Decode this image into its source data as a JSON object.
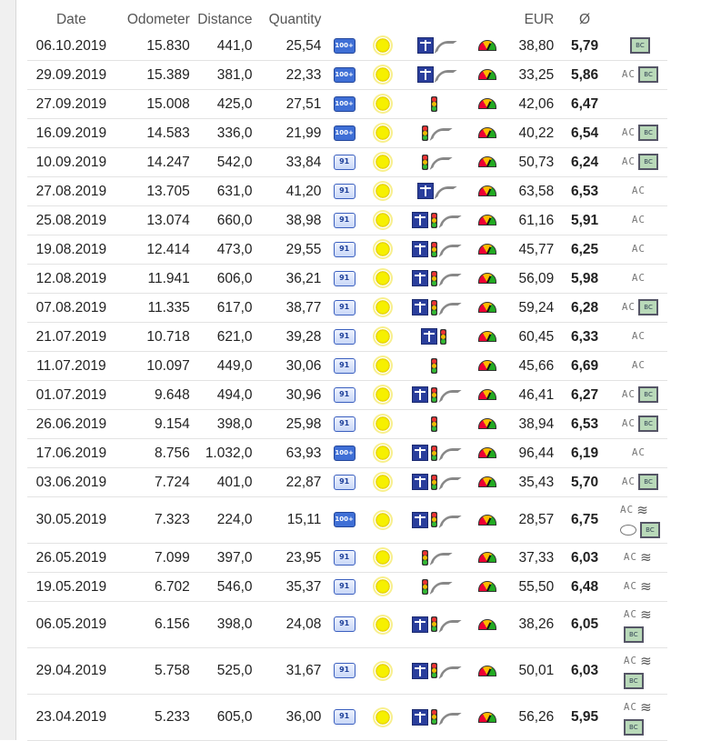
{
  "headers": {
    "date": "Date",
    "odometer": "Odometer",
    "distance": "Distance",
    "quantity": "Quantity",
    "eur": "EUR",
    "avg": "Ø"
  },
  "icons": {
    "fuel_100": "100+",
    "fuel_91": "91",
    "ac": "AC",
    "bc": "BC",
    "heat": "≋"
  },
  "rows": [
    {
      "date": "06.10.2019",
      "odometer": "15.830",
      "distance": "441,0",
      "quantity": "25,54",
      "fuel": "100+",
      "road": [
        "hw",
        "cv"
      ],
      "eur": "38,80",
      "avg": "5,79",
      "extras": [
        "bc"
      ]
    },
    {
      "date": "29.09.2019",
      "odometer": "15.389",
      "distance": "381,0",
      "quantity": "22,33",
      "fuel": "100+",
      "road": [
        "hw",
        "cv"
      ],
      "eur": "33,25",
      "avg": "5,86",
      "extras": [
        "ac",
        "bc"
      ]
    },
    {
      "date": "27.09.2019",
      "odometer": "15.008",
      "distance": "425,0",
      "quantity": "27,51",
      "fuel": "100+",
      "road": [
        "tl"
      ],
      "eur": "42,06",
      "avg": "6,47",
      "extras": []
    },
    {
      "date": "16.09.2019",
      "odometer": "14.583",
      "distance": "336,0",
      "quantity": "21,99",
      "fuel": "100+",
      "road": [
        "tl",
        "cv"
      ],
      "eur": "40,22",
      "avg": "6,54",
      "extras": [
        "ac",
        "bc"
      ]
    },
    {
      "date": "10.09.2019",
      "odometer": "14.247",
      "distance": "542,0",
      "quantity": "33,84",
      "fuel": "91",
      "road": [
        "tl",
        "cv"
      ],
      "eur": "50,73",
      "avg": "6,24",
      "extras": [
        "ac",
        "bc"
      ]
    },
    {
      "date": "27.08.2019",
      "odometer": "13.705",
      "distance": "631,0",
      "quantity": "41,20",
      "fuel": "91",
      "road": [
        "hw",
        "cv"
      ],
      "eur": "63,58",
      "avg": "6,53",
      "extras": [
        "ac"
      ]
    },
    {
      "date": "25.08.2019",
      "odometer": "13.074",
      "distance": "660,0",
      "quantity": "38,98",
      "fuel": "91",
      "road": [
        "hw",
        "tl",
        "cv"
      ],
      "eur": "61,16",
      "avg": "5,91",
      "extras": [
        "ac"
      ]
    },
    {
      "date": "19.08.2019",
      "odometer": "12.414",
      "distance": "473,0",
      "quantity": "29,55",
      "fuel": "91",
      "road": [
        "hw",
        "tl",
        "cv"
      ],
      "eur": "45,77",
      "avg": "6,25",
      "extras": [
        "ac"
      ]
    },
    {
      "date": "12.08.2019",
      "odometer": "11.941",
      "distance": "606,0",
      "quantity": "36,21",
      "fuel": "91",
      "road": [
        "hw",
        "tl",
        "cv"
      ],
      "eur": "56,09",
      "avg": "5,98",
      "extras": [
        "ac"
      ]
    },
    {
      "date": "07.08.2019",
      "odometer": "11.335",
      "distance": "617,0",
      "quantity": "38,77",
      "fuel": "91",
      "road": [
        "hw",
        "tl",
        "cv"
      ],
      "eur": "59,24",
      "avg": "6,28",
      "extras": [
        "ac",
        "bc"
      ]
    },
    {
      "date": "21.07.2019",
      "odometer": "10.718",
      "distance": "621,0",
      "quantity": "39,28",
      "fuel": "91",
      "road": [
        "hw",
        "tl"
      ],
      "eur": "60,45",
      "avg": "6,33",
      "extras": [
        "ac"
      ]
    },
    {
      "date": "11.07.2019",
      "odometer": "10.097",
      "distance": "449,0",
      "quantity": "30,06",
      "fuel": "91",
      "road": [
        "tl"
      ],
      "eur": "45,66",
      "avg": "6,69",
      "extras": [
        "ac"
      ]
    },
    {
      "date": "01.07.2019",
      "odometer": "9.648",
      "distance": "494,0",
      "quantity": "30,96",
      "fuel": "91",
      "road": [
        "hw",
        "tl",
        "cv"
      ],
      "eur": "46,41",
      "avg": "6,27",
      "extras": [
        "ac",
        "bc"
      ]
    },
    {
      "date": "26.06.2019",
      "odometer": "9.154",
      "distance": "398,0",
      "quantity": "25,98",
      "fuel": "91",
      "road": [
        "tl"
      ],
      "eur": "38,94",
      "avg": "6,53",
      "extras": [
        "ac",
        "bc"
      ]
    },
    {
      "date": "17.06.2019",
      "odometer": "8.756",
      "distance": "1.032,0",
      "quantity": "63,93",
      "fuel": "100+",
      "road": [
        "hw",
        "tl",
        "cv"
      ],
      "eur": "96,44",
      "avg": "6,19",
      "extras": [
        "ac"
      ]
    },
    {
      "date": "03.06.2019",
      "odometer": "7.724",
      "distance": "401,0",
      "quantity": "22,87",
      "fuel": "91",
      "road": [
        "hw",
        "tl",
        "cv"
      ],
      "eur": "35,43",
      "avg": "5,70",
      "extras": [
        "ac",
        "bc"
      ]
    },
    {
      "date": "30.05.2019",
      "odometer": "7.323",
      "distance": "224,0",
      "quantity": "15,11",
      "fuel": "100+",
      "road": [
        "hw",
        "tl",
        "cv"
      ],
      "eur": "28,57",
      "avg": "6,75",
      "extras": [
        "ac",
        "heat",
        "br",
        "bubble",
        "bc"
      ],
      "tall": true
    },
    {
      "date": "26.05.2019",
      "odometer": "7.099",
      "distance": "397,0",
      "quantity": "23,95",
      "fuel": "91",
      "road": [
        "tl",
        "cv"
      ],
      "eur": "37,33",
      "avg": "6,03",
      "extras": [
        "ac",
        "heat"
      ]
    },
    {
      "date": "19.05.2019",
      "odometer": "6.702",
      "distance": "546,0",
      "quantity": "35,37",
      "fuel": "91",
      "road": [
        "tl",
        "cv"
      ],
      "eur": "55,50",
      "avg": "6,48",
      "extras": [
        "ac",
        "heat"
      ]
    },
    {
      "date": "06.05.2019",
      "odometer": "6.156",
      "distance": "398,0",
      "quantity": "24,08",
      "fuel": "91",
      "road": [
        "hw",
        "tl",
        "cv"
      ],
      "eur": "38,26",
      "avg": "6,05",
      "extras": [
        "ac",
        "heat",
        "br",
        "bc"
      ],
      "tall": true
    },
    {
      "date": "29.04.2019",
      "odometer": "5.758",
      "distance": "525,0",
      "quantity": "31,67",
      "fuel": "91",
      "road": [
        "hw",
        "tl",
        "cv"
      ],
      "eur": "50,01",
      "avg": "6,03",
      "extras": [
        "ac",
        "heat",
        "br",
        "bc"
      ],
      "tall": true
    },
    {
      "date": "23.04.2019",
      "odometer": "5.233",
      "distance": "605,0",
      "quantity": "36,00",
      "fuel": "91",
      "road": [
        "hw",
        "tl",
        "cv"
      ],
      "eur": "56,26",
      "avg": "5,95",
      "extras": [
        "ac",
        "heat",
        "br",
        "bc"
      ],
      "tall": true
    }
  ]
}
